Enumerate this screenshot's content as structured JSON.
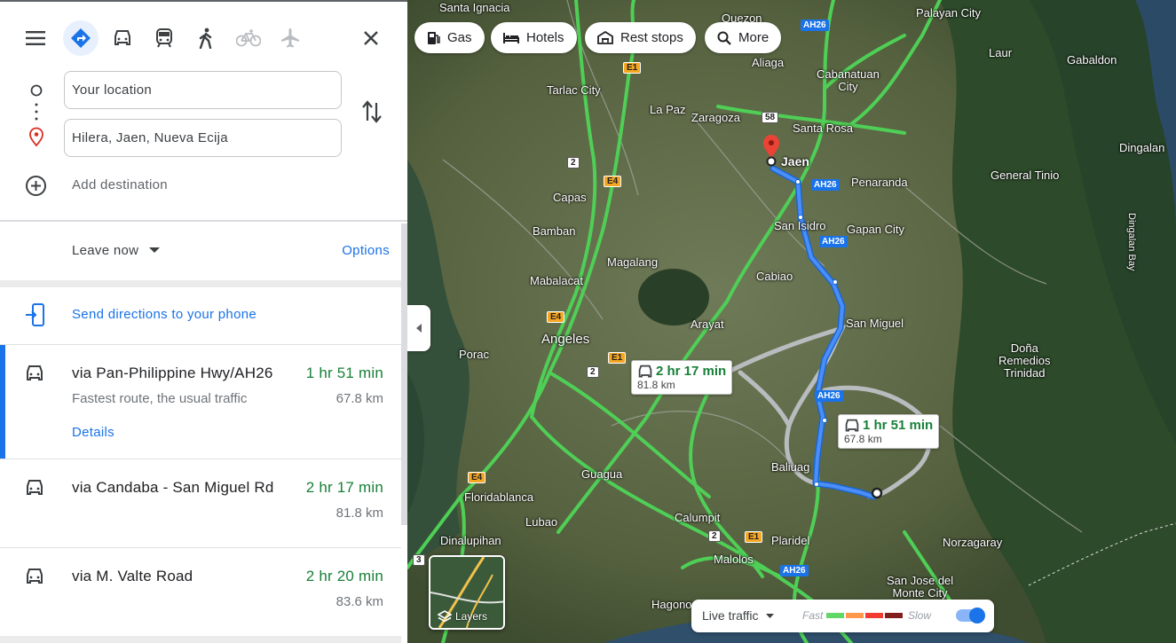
{
  "modes": {
    "menu_icon": "menu-icon",
    "items": [
      {
        "name": "best-travel-mode",
        "icon": "directions-icon",
        "active": true
      },
      {
        "name": "driving",
        "icon": "car-icon"
      },
      {
        "name": "transit",
        "icon": "train-icon"
      },
      {
        "name": "walking",
        "icon": "walk-icon"
      },
      {
        "name": "cycling",
        "icon": "bike-icon"
      },
      {
        "name": "flights",
        "icon": "plane-icon"
      }
    ],
    "close_icon": "close-icon"
  },
  "inputs": {
    "origin": "Your location",
    "destination": "Hilera, Jaen, Nueva Ecija",
    "add_destination": "Add destination"
  },
  "options": {
    "leave_now": "Leave now",
    "options_link": "Options"
  },
  "send_to_phone": "Send directions to your phone",
  "routes": [
    {
      "name": "via Pan-Philippine Hwy/AH26",
      "time": "1 hr 51 min",
      "sub": "Fastest route, the usual traffic",
      "distance": "67.8 km",
      "details": "Details"
    },
    {
      "name": "via Candaba - San Miguel Rd",
      "time": "2 hr 17 min",
      "distance": "81.8 km"
    },
    {
      "name": "via M. Valte Road",
      "time": "2 hr 20 min",
      "distance": "83.6 km"
    }
  ],
  "chips": {
    "gas": "Gas",
    "hotels": "Hotels",
    "rest_stops": "Rest stops",
    "more": "More"
  },
  "map": {
    "places": {
      "santa_ignacia": "Santa Ignacia",
      "quezon": "Quezon",
      "palayan": "Palayan City",
      "aliaga": "Aliaga",
      "laur": "Laur",
      "gabaldon": "Gabaldon",
      "tarlac": "Tarlac City",
      "cabanatuan": "Cabanatuan\nCity",
      "la_paz": "La Paz",
      "zaragoza": "Zaragoza",
      "santa_rosa": "Santa Rosa",
      "dingalan": "Dingalan",
      "jaen": "Jaen",
      "penaranda": "Penaranda",
      "general_tinio": "General Tinio",
      "capas": "Capas",
      "san_isidro": "San Isidro",
      "gapan": "Gapan City",
      "bamban": "Bamban",
      "magalang": "Magalang",
      "cabiao": "Cabiao",
      "mabalacat": "Mabalacat",
      "arayat": "Arayat",
      "san_miguel": "San Miguel",
      "angeles": "Angeles",
      "porac": "Porac",
      "dona_remedios": "Doña\nRemedios\nTrinidad",
      "baliuag": "Baliuag",
      "guagua": "Guagua",
      "floridablanca": "Floridablanca",
      "lubao": "Lubao",
      "calumpit": "Calumpit",
      "dinalupihan": "Dinalupihan",
      "plaridel": "Plaridel",
      "norzagaray": "Norzagaray",
      "malolos": "Malolos",
      "san_jose": "San Jose del\nMonte City",
      "hagonoy": "Hagono",
      "dingalan_bay": "Dingalan Bay"
    },
    "shields": {
      "ah26": "AH26",
      "e1": "E1",
      "e4": "E4",
      "r2": "2",
      "r58": "58",
      "r3": "3"
    },
    "callout_alt": {
      "time": "2 hr 17 min",
      "distance": "81.8 km"
    },
    "callout_main": {
      "time": "1 hr 51 min",
      "distance": "67.8 km"
    },
    "layers_label": "Layers",
    "traffic": {
      "label": "Live traffic",
      "fast": "Fast",
      "slow": "Slow",
      "colors": [
        "#63d668",
        "#ff974d",
        "#f23c32",
        "#811f1f"
      ]
    }
  }
}
